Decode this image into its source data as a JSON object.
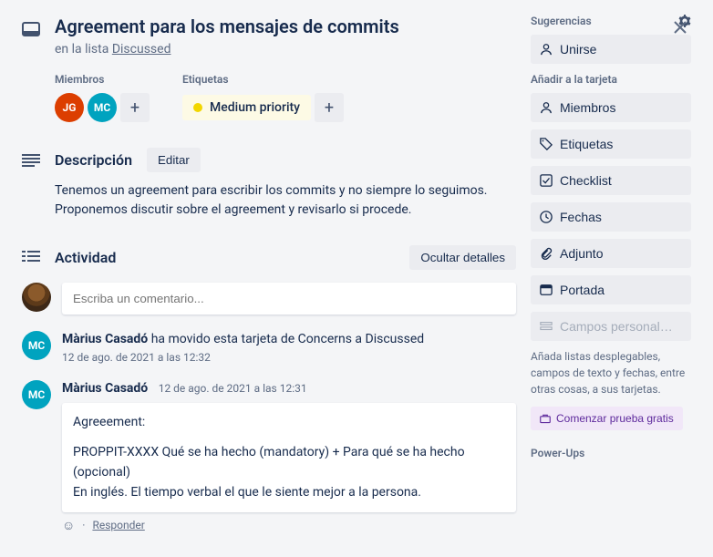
{
  "title": "Agreement para los mensajes de commits",
  "listPrefix": "en la lista ",
  "listName": "Discussed",
  "members": {
    "label": "Miembros",
    "items": [
      {
        "initials": "JG",
        "cls": "jg"
      },
      {
        "initials": "MC",
        "cls": "mc"
      }
    ]
  },
  "labels": {
    "label": "Etiquetas",
    "tag": "Medium priority"
  },
  "description": {
    "title": "Descripción",
    "edit": "Editar",
    "body": "Tenemos un agreement para escribir los commits y no siempre lo seguimos. Proponemos discutir sobre el agreement y revisarlo si procede."
  },
  "activity": {
    "title": "Actividad",
    "hide": "Ocultar detalles",
    "placeholder": "Escriba un comentario..."
  },
  "act1": {
    "name": "Màrius Casadó",
    "text": " ha movido esta tarjeta de Concerns a Discussed",
    "time": "12 de ago. de 2021 a las 12:32"
  },
  "act2": {
    "name": "Màrius Casadó",
    "time": "12 de ago. de 2021 a las 12:31",
    "line1": "Agreeement:",
    "line2": "PROPPIT-XXXX Qué se ha hecho (mandatory) + Para qué se ha hecho (opcional)",
    "line3": "En inglés. El tiempo verbal el que le siente mejor a la persona.",
    "reply": "Responder"
  },
  "side": {
    "suggestions": "Sugerencias",
    "join": "Unirse",
    "addTitle": "Añadir a la tarjeta",
    "members": "Miembros",
    "labels": "Etiquetas",
    "checklist": "Checklist",
    "dates": "Fechas",
    "attach": "Adjunto",
    "cover": "Portada",
    "custom": "Campos personal…",
    "note": "Añada listas desplegables, campos de texto y fechas, entre otras cosas, a sus tarjetas.",
    "trial": "Comenzar prueba gratis",
    "powerups": "Power-Ups"
  }
}
